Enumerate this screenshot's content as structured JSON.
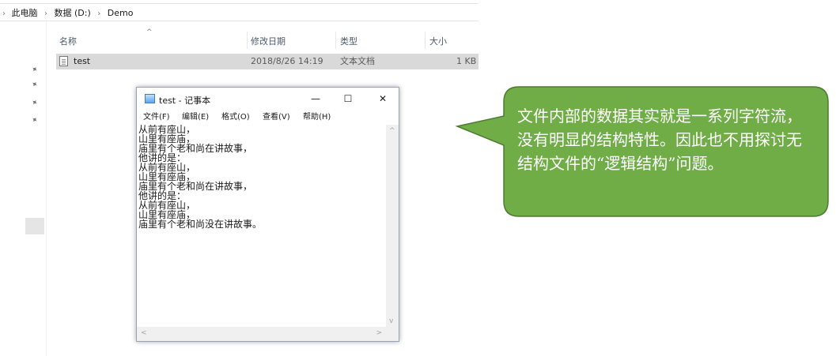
{
  "breadcrumb": {
    "items": [
      "此电脑",
      "数据 (D:)",
      "Demo"
    ]
  },
  "columns": [
    "名称",
    "修改日期",
    "类型",
    "大小"
  ],
  "file": {
    "name": "test",
    "modified": "2018/8/26 14:19",
    "type": "文本文档",
    "size": "1 KB"
  },
  "notepad": {
    "title": "test - 记事本",
    "menu": [
      "文件(F)",
      "编辑(E)",
      "格式(O)",
      "查看(V)",
      "帮助(H)"
    ],
    "controls": {
      "minimize": "—",
      "maximize": "☐",
      "close": "✕"
    },
    "lines": [
      "从前有座山，",
      "山里有座庙，",
      "庙里有个老和尚在讲故事，",
      "他讲的是：",
      "从前有座山，",
      "山里有座庙，",
      "庙里有个老和尚在讲故事，",
      "他讲的是：",
      "从前有座山，",
      "山里有座庙，",
      "庙里有个老和尚没在讲故事。"
    ]
  },
  "callout": {
    "text": "文件内部的数据其实就是一系列字符流，没有明显的结构特性。因此也不用探讨无结构文件的“逻辑结构”问题。",
    "fill": "#70ad47",
    "stroke": "#4e7a31"
  }
}
